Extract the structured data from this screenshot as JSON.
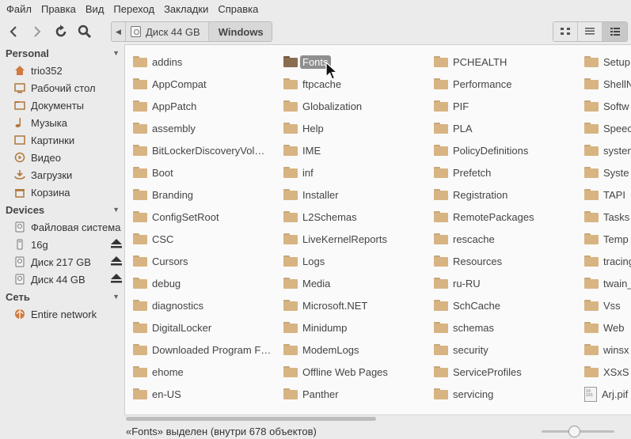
{
  "menubar": [
    "Файл",
    "Правка",
    "Вид",
    "Переход",
    "Закладки",
    "Справка"
  ],
  "toolbar": {
    "back_icon": "back-arrow-icon",
    "forward_icon": "forward-arrow-icon",
    "reload_icon": "reload-icon",
    "search_icon": "search-icon"
  },
  "pathbar": {
    "segments": [
      "Диск 44 GB",
      "Windows"
    ]
  },
  "view_modes": [
    "icon-view",
    "list-view",
    "compact-view"
  ],
  "sidebar": {
    "personal": {
      "title": "Personal",
      "items": [
        {
          "label": "trio352",
          "icon": "home-icon"
        },
        {
          "label": "Рабочий стол",
          "icon": "desktop-icon"
        },
        {
          "label": "Документы",
          "icon": "documents-icon"
        },
        {
          "label": "Музыка",
          "icon": "music-icon"
        },
        {
          "label": "Картинки",
          "icon": "pictures-icon"
        },
        {
          "label": "Видео",
          "icon": "video-icon"
        },
        {
          "label": "Загрузки",
          "icon": "downloads-icon"
        },
        {
          "label": "Корзина",
          "icon": "trash-icon"
        }
      ]
    },
    "devices": {
      "title": "Devices",
      "items": [
        {
          "label": "Файловая система",
          "icon": "filesystem-icon"
        },
        {
          "label": "16g",
          "icon": "usb-drive-icon"
        },
        {
          "label": "Диск 217 GB",
          "icon": "disk-icon"
        },
        {
          "label": "Диск 44 GB",
          "icon": "disk-icon"
        }
      ]
    },
    "network": {
      "title": "Сеть",
      "items": [
        {
          "label": "Entire network",
          "icon": "network-icon"
        }
      ]
    }
  },
  "files": {
    "columns": [
      [
        "addins",
        "AppCompat",
        "AppPatch",
        "assembly",
        "BitLockerDiscoveryVol…",
        "Boot",
        "Branding",
        "ConfigSetRoot",
        "CSC",
        "Cursors",
        "debug",
        "diagnostics",
        "DigitalLocker",
        "Downloaded Program F…",
        "ehome",
        "en-US"
      ],
      [
        "Fonts",
        "ftpcache",
        "Globalization",
        "Help",
        "IME",
        "inf",
        "Installer",
        "L2Schemas",
        "LiveKernelReports",
        "Logs",
        "Media",
        "Microsoft.NET",
        "Minidump",
        "ModemLogs",
        "Offline Web Pages",
        "Panther"
      ],
      [
        "PCHEALTH",
        "Performance",
        "PIF",
        "PLA",
        "PolicyDefinitions",
        "Prefetch",
        "Registration",
        "RemotePackages",
        "rescache",
        "Resources",
        "ru-RU",
        "SchCache",
        "schemas",
        "security",
        "ServiceProfiles",
        "servicing"
      ],
      [
        "Setup",
        "ShellN",
        "Softw",
        "Speec",
        "system",
        "Syste",
        "TAPI",
        "Tasks",
        "Temp",
        "tracing",
        "twain_",
        "Vss",
        "Web",
        "winsx",
        "XSxS",
        "Arj.pif"
      ]
    ],
    "selected": "Fonts",
    "non_folder": [
      "Arj.pif"
    ]
  },
  "status": {
    "text": "«Fonts» выделен (внутри 678 объектов)",
    "zoom_level": 0.45
  }
}
